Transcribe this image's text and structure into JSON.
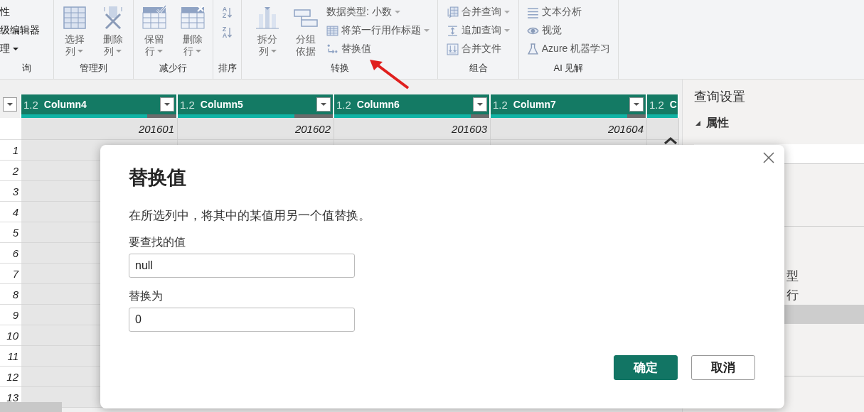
{
  "ribbon": {
    "groups": [
      {
        "label": "询",
        "items": [
          {
            "kind": "small",
            "label": "性",
            "dropdown": false
          },
          {
            "kind": "small",
            "label": "级编辑器",
            "dropdown": false
          },
          {
            "kind": "small",
            "label": "理",
            "dropdown": true
          }
        ]
      },
      {
        "label": "管理列",
        "items": [
          {
            "kind": "large",
            "lines": [
              "选择",
              "列"
            ],
            "dropdown": true
          },
          {
            "kind": "large",
            "lines": [
              "删除",
              "列"
            ],
            "dropdown": true
          }
        ]
      },
      {
        "label": "减少行",
        "items": [
          {
            "kind": "large",
            "lines": [
              "保留",
              "行"
            ],
            "dropdown": true
          },
          {
            "kind": "large",
            "lines": [
              "删除",
              "行"
            ],
            "dropdown": true
          }
        ]
      },
      {
        "label": "排序",
        "items": [
          {
            "kind": "sort",
            "letters": [
              "A",
              "Z"
            ]
          },
          {
            "kind": "sort",
            "letters": [
              "Z",
              "A"
            ]
          }
        ]
      },
      {
        "label": "转换",
        "items": [
          {
            "kind": "large",
            "lines": [
              "拆分",
              "列"
            ],
            "dropdown": true
          },
          {
            "kind": "large",
            "lines": [
              "分组",
              "依据"
            ],
            "dropdown": false
          },
          {
            "kind": "small",
            "label": "数据类型: 小数",
            "dropdown": true
          },
          {
            "kind": "small",
            "label": "将第一行用作标题",
            "dropdown": true
          },
          {
            "kind": "small",
            "label": "替换值",
            "dropdown": false
          }
        ]
      },
      {
        "label": "组合",
        "items": [
          {
            "kind": "small",
            "label": "合并查询",
            "dropdown": true
          },
          {
            "kind": "small",
            "label": "追加查询",
            "dropdown": true
          },
          {
            "kind": "small",
            "label": "合并文件",
            "dropdown": false
          }
        ]
      },
      {
        "label": "AI 见解",
        "items": [
          {
            "kind": "small",
            "label": "文本分析",
            "dropdown": false
          },
          {
            "kind": "small",
            "label": "视觉",
            "dropdown": false
          },
          {
            "kind": "small",
            "label": "Azure 机器学习",
            "dropdown": false
          }
        ]
      }
    ]
  },
  "grid": {
    "columns": [
      {
        "type": "1.2",
        "name": "Column4",
        "level": 0.81,
        "value": "201601"
      },
      {
        "type": "1.2",
        "name": "Column5",
        "level": 0.75,
        "value": "201602"
      },
      {
        "type": "1.2",
        "name": "Column6",
        "level": 0.88,
        "value": "201603"
      },
      {
        "type": "1.2",
        "name": "Column7",
        "level": 0.88,
        "value": "201604"
      },
      {
        "type": "1.2",
        "name": "C",
        "level": 1
      }
    ],
    "row_numbers": [
      "1",
      "2",
      "3",
      "4",
      "5",
      "6",
      "7",
      "8",
      "9",
      "10",
      "11",
      "12",
      "13"
    ]
  },
  "pane": {
    "title": "查询设置",
    "section": "属性",
    "steps": [
      {
        "label": "型",
        "selected": false
      },
      {
        "label": "行",
        "selected": false
      },
      {
        "selected": true
      }
    ]
  },
  "dialog": {
    "title": "替换值",
    "description": "在所选列中，将其中的某值用另一个值替换。",
    "fields": [
      {
        "label": "要查找的值",
        "value": "null"
      },
      {
        "label": "替换为",
        "value": "0"
      }
    ],
    "buttons": [
      {
        "label": "确定",
        "primary": true
      },
      {
        "label": "取消",
        "primary": false
      }
    ]
  }
}
